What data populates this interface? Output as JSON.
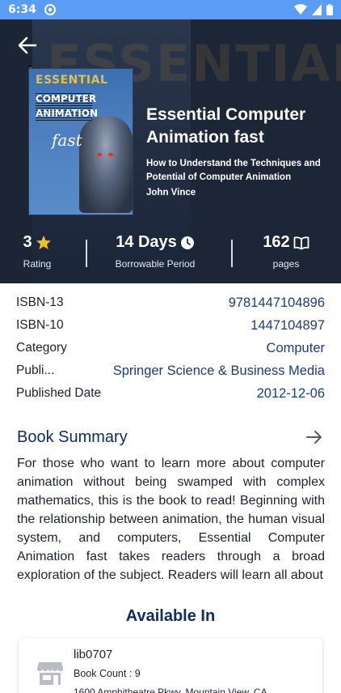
{
  "status_bar": {
    "time": "6:34"
  },
  "book": {
    "cover_title": "ESSENTIAL",
    "cover_title2": "COMPUTER ANIMATION",
    "cover_fast": "fast",
    "title": "Essential Computer Animation fast",
    "subtitle": "How to Understand the Techniques and Potential of Computer Animation",
    "author": "John Vince"
  },
  "stats": {
    "rating_value": "3",
    "rating_label": "Rating",
    "period_value": "14 Days",
    "period_label": "Borrowable Period",
    "pages_value": "162",
    "pages_label": "pages"
  },
  "details": {
    "isbn13_label": "ISBN-13",
    "isbn13_value": "9781447104896",
    "isbn10_label": "ISBN-10",
    "isbn10_value": "1447104897",
    "category_label": "Category",
    "category_value": "Computer",
    "publisher_label": "Publi...",
    "publisher_value": "Springer Science & Business Media",
    "published_label": "Published Date",
    "published_value": "2012-12-06"
  },
  "summary": {
    "title": "Book Summary",
    "text": "For those who want to learn more about computer animation without being swamped with complex mathematics, this is the book to read! Beginning with the relationship between animation, the human visual system, and computers, Essential Computer Animation fast takes readers through a broad exploration of the subject. Readers will learn all about"
  },
  "available": {
    "title": "Available In",
    "libraries": [
      {
        "name": "lib0707",
        "count": "Book Count : 9",
        "address": "1600 Amphitheatre Pkwy, Mountain View, CA"
      }
    ]
  },
  "colors": {
    "status_bar": "#5b9cf6",
    "hero_bg": "#1f2a3c",
    "accent_navy": "#0f2d63",
    "value_blue": "#1b3d7a",
    "star": "#f2c21b"
  }
}
